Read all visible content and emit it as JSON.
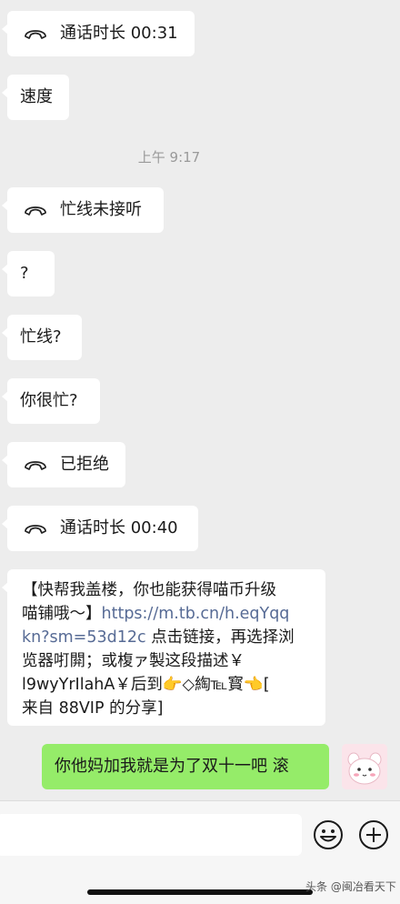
{
  "messages": {
    "call1": "通话时长 00:31",
    "msg_speed": "速度",
    "timestamp": "上午 9:17",
    "call2": "忙线未接听",
    "msg_q": "?",
    "msg_busy": "忙线?",
    "msg_are_busy": "你很忙?",
    "call3": "已拒绝",
    "call4": "通话时长 00:40",
    "share": {
      "line1": "【快帮我盖楼，你也能获得喵币升级",
      "line2_prefix": "喵铺哦～】",
      "link_part1": "https://m.tb.cn/h.eqYqq",
      "link_part2": "kn?sm=53d12c",
      "line3_suffix": " 点击链接，再选择浏",
      "line4": "览器咑閞；或椱ァ製这段描述￥",
      "line5": "l9wyYrIlahA￥后到👉◇綯℡寳👈[",
      "line6": "来自 88VIP 的分享]"
    },
    "outgoing": "你他妈加我就是为了双十一吧 滚"
  },
  "watermark": "头条 @闽冶看天下",
  "colors": {
    "background": "#ededed",
    "bubble_in": "#ffffff",
    "bubble_out": "#95ec69",
    "link": "#576b95"
  },
  "icons": [
    "phone-hangup-icon",
    "emoji-icon",
    "plus-icon"
  ]
}
